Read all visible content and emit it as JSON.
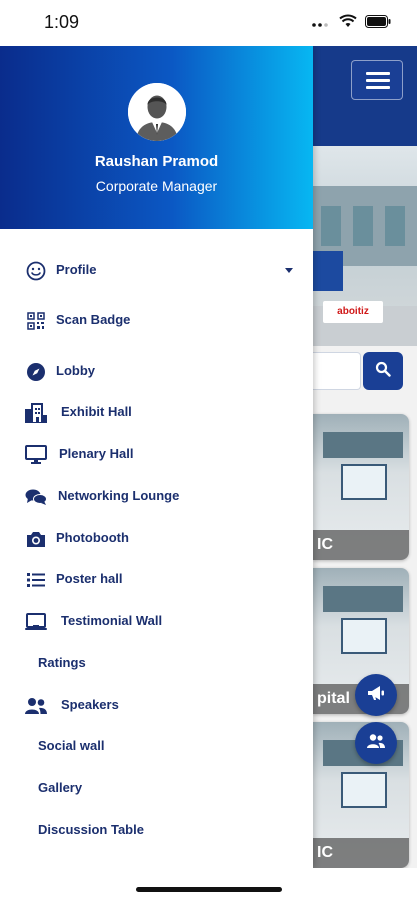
{
  "status_bar": {
    "time": "1:09"
  },
  "user": {
    "name": "Raushan Pramod",
    "role": "Corporate Manager"
  },
  "menu": {
    "items": [
      {
        "label": "Profile",
        "icon": "smile-icon",
        "has_caret": true
      },
      {
        "label": "Scan Badge",
        "icon": "qr-code-icon"
      },
      {
        "label": "Lobby",
        "icon": "compass-icon"
      },
      {
        "label": "Exhibit Hall",
        "icon": "building-icon"
      },
      {
        "label": "Plenary Hall",
        "icon": "monitor-icon"
      },
      {
        "label": "Networking Lounge",
        "icon": "chat-bubbles-icon"
      },
      {
        "label": "Photobooth",
        "icon": "camera-icon"
      },
      {
        "label": "Poster hall",
        "icon": "list-icon"
      },
      {
        "label": "Testimonial Wall",
        "icon": "laptop-icon"
      },
      {
        "label": "Ratings",
        "icon": ""
      },
      {
        "label": "Speakers",
        "icon": "users-icon"
      },
      {
        "label": "Social wall",
        "icon": ""
      },
      {
        "label": "Gallery",
        "icon": ""
      },
      {
        "label": "Discussion Table",
        "icon": ""
      }
    ]
  },
  "background": {
    "hero_sign": "aboitiz",
    "booth_labels": [
      "IC",
      "pital",
      "IC"
    ]
  },
  "colors": {
    "brand_dark": "#0a2c8c",
    "brand_mid": "#0b58c4",
    "brand_light": "#07b7f2",
    "menu_text": "#1b2f6e",
    "fab": "#1a3f95"
  }
}
